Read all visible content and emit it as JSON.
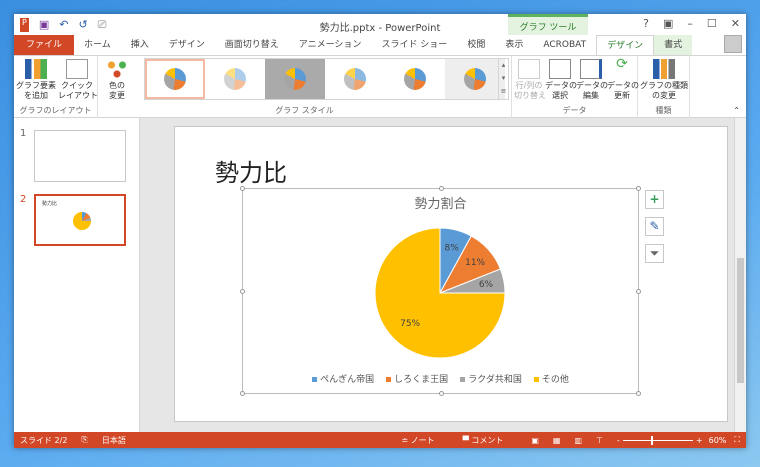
{
  "titlebar": {
    "title": "勢力比.pptx - PowerPoint",
    "context_group": "グラフ ツール",
    "help": "?",
    "qa": {
      "save": "💾",
      "undo": "↶",
      "redo": "↺"
    }
  },
  "tabs": [
    "ファイル",
    "ホーム",
    "挿入",
    "デザイン",
    "画面切り替え",
    "アニメーション",
    "スライド ショー",
    "校閲",
    "表示",
    "ACROBAT",
    "デザイン",
    "書式"
  ],
  "ribbon": {
    "layout_group": {
      "label": "グラフのレイアウト",
      "add_element": "グラフ要素\nを追加",
      "quick_layout": "クイック\nレイアウト"
    },
    "styles_group": {
      "label": "グラフ スタイル",
      "change_colors": "色の\n変更"
    },
    "data_group": {
      "label": "データ",
      "switch": "行/列の\n切り替え",
      "select": "データの\n選択",
      "edit": "データの\n編集",
      "refresh": "データの\n更新"
    },
    "type_group": {
      "label": "種類",
      "change_type": "グラフの種類\nの変更"
    }
  },
  "thumbnails": [
    {
      "num": "1"
    },
    {
      "num": "2",
      "title": "勢力比"
    }
  ],
  "slide": {
    "title": "勢力比"
  },
  "chart_data": {
    "type": "pie",
    "title": "勢力割合",
    "categories": [
      "ぺんぎん帝国",
      "しろくま王国",
      "ラクダ共和国",
      "その他"
    ],
    "values": [
      8,
      11,
      6,
      75
    ],
    "labels": [
      "8%",
      "11%",
      "6%",
      "75%"
    ],
    "colors": [
      "#5b9bd5",
      "#ed7d31",
      "#a5a5a5",
      "#ffc000"
    ],
    "legend": "bottom"
  },
  "status": {
    "slide": "スライド 2/2",
    "language": "日本語",
    "notes": "ノート",
    "comments": "コメント",
    "zoom": "60%",
    "zoom_value": 60
  }
}
